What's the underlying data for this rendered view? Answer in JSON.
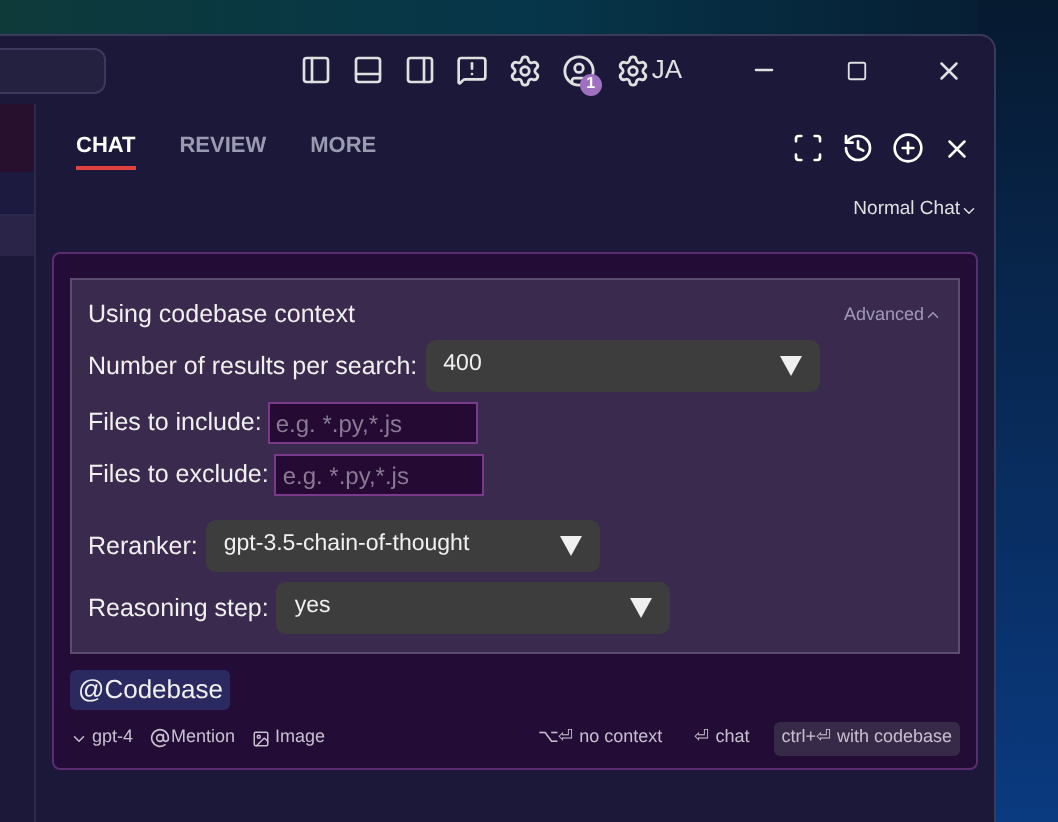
{
  "title_bar": {
    "user_initials": "JA",
    "notification_count": "1"
  },
  "tabs": [
    {
      "label": "CHAT",
      "selected": true
    },
    {
      "label": "REVIEW",
      "selected": false
    },
    {
      "label": "MORE",
      "selected": false
    }
  ],
  "mode": "Normal Chat",
  "context_panel": {
    "title": "Using codebase context",
    "advanced": "Advanced",
    "expanded": true,
    "fields": [
      {
        "kind": "select",
        "label": "Number of results per search:",
        "value": "400"
      },
      {
        "kind": "input",
        "label": "Files to include:",
        "placeholder": "e.g. *.py,*.js"
      },
      {
        "kind": "input",
        "label": "Files to exclude:",
        "placeholder": "e.g. *.py,*.js"
      },
      {
        "kind": "select",
        "label": "Reranker:",
        "value": "gpt-3.5-chain-of-thought"
      },
      {
        "kind": "select",
        "label": "Reasoning step:",
        "value": "yes"
      }
    ]
  },
  "mention_chip": "@Codebase",
  "footer": {
    "model": "gpt-4",
    "mention": "Mention",
    "image": "Image",
    "shortcuts": [
      {
        "label": "⌥⏎ no context",
        "selected": false
      },
      {
        "label": "⏎ chat",
        "selected": false
      },
      {
        "label": "ctrl+⏎ with codebase",
        "selected": true
      }
    ]
  }
}
